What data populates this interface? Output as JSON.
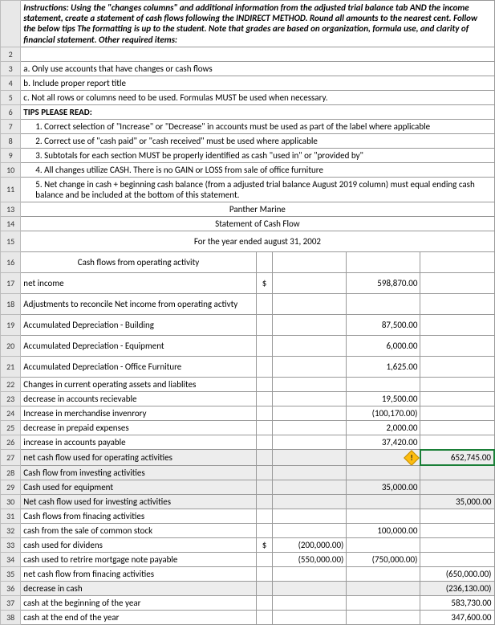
{
  "instructions": {
    "intro": "Instructions: Using the \"changes columns\" and additional information from the adjusted trial balance tab AND the income statement, create a statement of cash flows following the INDIRECT METHOD. Round all amounts to the nearest cent. Follow the below tips The formatting is up to the student. Note that grades are based on organization, formula use, and clarity of financial statement. Other required items:",
    "a": "a. Only use accounts that have changes or cash flows",
    "b": "b. Include proper report title",
    "c": "c. Not all rows or columns need to be used. Formulas MUST be used when necessary."
  },
  "tips": {
    "header": "TIPS PLEASE READ:",
    "t1": "1. Correct selection of \"Increase\" or \"Decrease\" in accounts must be used as part of the label where applicable",
    "t2": "2. Correct use of \"cash paid\" or \"cash received\" must be used where applicable",
    "t3": "3. Subtotals for each section MUST be properly identified as cash \"used in\" or \"provided by\"",
    "t4": "4. All changes utilize CASH. There is no GAIN or LOSS from sale of office furniture",
    "t5": "5. Net change in cash + beginning cash balance (from a adjusted trial balance August 2019 column) must equal ending cash balance and be included at the bottom of this statement."
  },
  "title": {
    "company": "Panther Marine",
    "statement": "Statement of Cash Flow",
    "period": "For the year ended august 31, 2002"
  },
  "labels": {
    "op_header": "Cash flows from operating activity",
    "net_income": "net income",
    "adjustments": "Adjustments to reconcile Net income from operating activty",
    "dep_building": "Accumulated Depreciation - Building",
    "dep_equipment": "Accumulated Depreciation - Equipment",
    "dep_furniture": "Accumulated Depreciation - Office Furniture",
    "changes_header": "Changes in current operating assets and liablites",
    "dec_ar": "decrease in accounts recievable",
    "inc_inventory": "Increase in merchandise invenrory",
    "dec_prepaid": "decrease in prepaid expenses",
    "inc_ap": "increase in accounts payable",
    "net_op": "net cash flow used for operating activities",
    "inv_header": "Cash flow from investing activities",
    "cash_equipment": "Cash used for equipment",
    "net_inv": "Net cash flow used for investing activities",
    "fin_header": "Cash flows from finacing activities",
    "sale_stock": "cash from the sale of common stock",
    "dividends": "cash used for dividens",
    "mortgage": "cash used to retrire mortgage note payable",
    "net_fin": "net cash flow from finacing activities",
    "dec_cash": "decrease in cash",
    "beg_cash": "cash at the beginning of the year",
    "end_cash": "cash at the end of the year"
  },
  "values": {
    "dollar": "$",
    "net_income": "598,870.00",
    "dep_building": "87,500.00",
    "dep_equipment": "6,000.00",
    "dep_furniture": "1,625.00",
    "dec_ar": "19,500.00",
    "inc_inventory": "(100,170.00)",
    "dec_prepaid": "2,000.00",
    "inc_ap": "37,420.00",
    "net_op": "652,745.00",
    "cash_equipment": "35,000.00",
    "net_inv": "35,000.00",
    "sale_stock": "100,000.00",
    "dividends_c": "(200,000.00)",
    "mortgage_c": "(550,000.00)",
    "mortgage_d": "(750,000.00)",
    "net_fin": "(650,000.00)",
    "dec_cash": "(236,130.00)",
    "beg_cash": "583,730.00",
    "end_cash": "347,600.00"
  },
  "rownums": {
    "r2": "2",
    "r3": "3",
    "r4": "4",
    "r5": "5",
    "r6": "6",
    "r7": "7",
    "r8": "8",
    "r9": "9",
    "r10": "10",
    "r11": "11",
    "r13": "13",
    "r14": "14",
    "r15": "15",
    "r16": "16",
    "r17": "17",
    "r18": "18",
    "r19": "19",
    "r20": "20",
    "r21": "21",
    "r22": "22",
    "r23": "23",
    "r24": "24",
    "r25": "25",
    "r26": "26",
    "r27": "27",
    "r28": "28",
    "r29": "29",
    "r30": "30",
    "r31": "31",
    "r32": "32",
    "r33": "33",
    "r34": "34",
    "r35": "35",
    "r36": "36",
    "r37": "37",
    "r38": "38"
  }
}
